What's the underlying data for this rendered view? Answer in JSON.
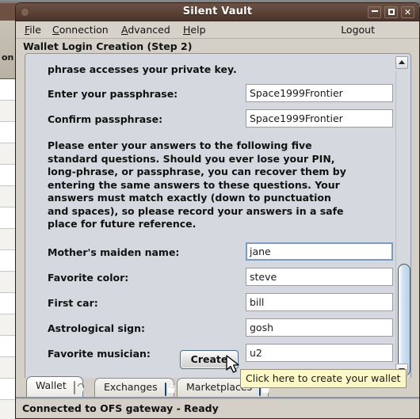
{
  "desktop": {
    "background_window_label": "on"
  },
  "window": {
    "title": "Silent Vault",
    "minimize_label": "_",
    "maximize_label": "□",
    "close_label": "✕"
  },
  "menubar": {
    "items": [
      {
        "label": "File",
        "accel": "F"
      },
      {
        "label": "Connection",
        "accel": "C"
      },
      {
        "label": "Advanced",
        "accel": "A"
      },
      {
        "label": "Help",
        "accel": "H"
      }
    ],
    "logout_label": "Logout"
  },
  "section": {
    "header": "Wallet Login Creation (Step 2)"
  },
  "form": {
    "lead_text": "phrase accesses your private key.",
    "passphrase_fields": [
      {
        "label": "Enter your passphrase:",
        "value": "Space1999Frontier",
        "focused": false
      },
      {
        "label": "Confirm passphrase:",
        "value": "Space1999Frontier",
        "focused": false
      }
    ],
    "paragraph": "Please enter your answers to the following five\nstandard questions.  Should you ever lose your PIN,\nlong-phrase, or passphrase, you can recover them by\nentering the same answers to these questions.  Your\nanswers must match exactly (down to punctuation\nand spaces), so please record your answers in a safe\nplace for future reference.",
    "questions": [
      {
        "label": "Mother's maiden name:",
        "value": "jane",
        "focused": true
      },
      {
        "label": "Favorite color:",
        "value": "steve",
        "focused": false
      },
      {
        "label": "First car:",
        "value": "bill",
        "focused": false
      },
      {
        "label": "Astrological sign:",
        "value": "gosh",
        "focused": false
      },
      {
        "label": "Favorite musician:",
        "value": "u2",
        "focused": false
      }
    ],
    "create_button": "Create"
  },
  "tooltip": {
    "text": "Click here to create your wallet"
  },
  "tabs": [
    {
      "label": "Wallet",
      "icon": "unlocked-padlock-icon",
      "active": true
    },
    {
      "label": "Exchanges",
      "icon": "lock-icon",
      "active": false
    },
    {
      "label": "Marketplaces",
      "icon": "lock-icon",
      "active": false
    }
  ],
  "statusbar": {
    "text": "Connected to OFS gateway - Ready"
  },
  "colors": {
    "titlebar": "#5a4036",
    "panel": "#d5d8de",
    "chrome": "#d4d0c8",
    "tooltip_bg": "#fdf8c8",
    "focus_border": "#7a9cc0",
    "lock_blue": "#1c63ab"
  }
}
